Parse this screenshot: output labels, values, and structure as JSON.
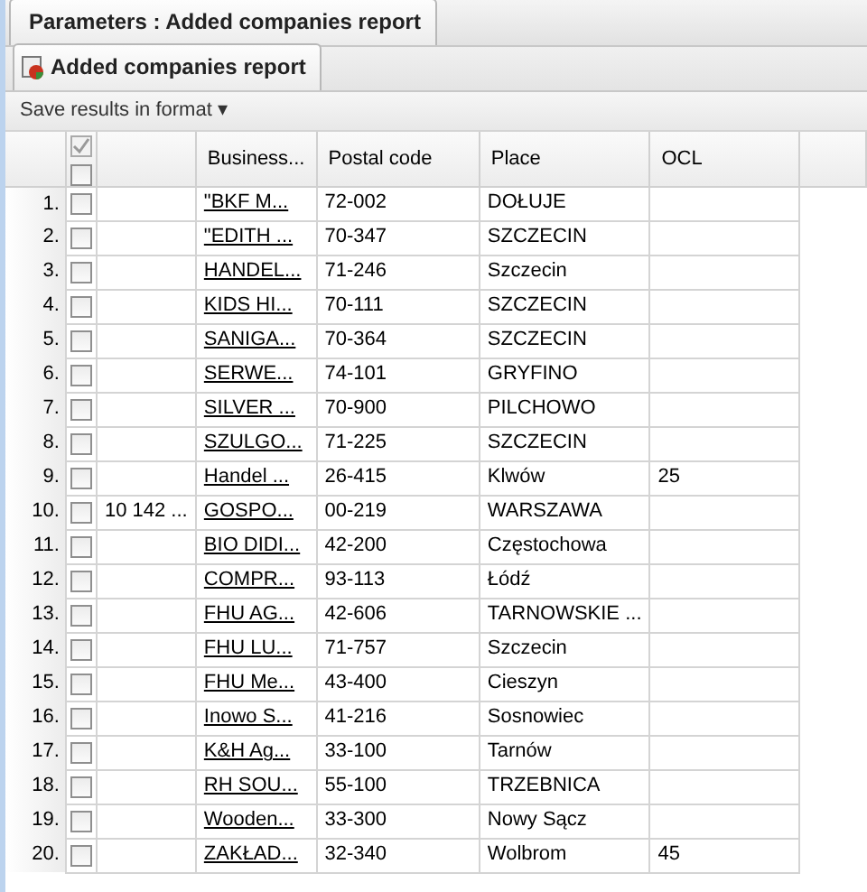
{
  "outer_tab": {
    "title": "Parameters : Added companies report",
    "selected": true
  },
  "inner_tab": {
    "title": "Added companies report",
    "selected": true
  },
  "toolbar": {
    "menu": "Save results in format",
    "caret": "▾"
  },
  "table": {
    "select_all_checked": false,
    "columns": [
      "",
      "Business...",
      "Postal code",
      "Place",
      "OCL"
    ],
    "rows": [
      {
        "number": "1.",
        "checked": false,
        "column_2": "",
        "business": "\"BKF M...",
        "postal_code": "72-002",
        "place": "DOŁUJE",
        "ocl": ""
      },
      {
        "number": "2.",
        "checked": false,
        "column_2": "",
        "business": "\"EDITH ...",
        "postal_code": "70-347",
        "place": "SZCZECIN",
        "ocl": ""
      },
      {
        "number": "3.",
        "checked": false,
        "column_2": "",
        "business": "HANDEL...",
        "postal_code": "71-246",
        "place": "Szczecin",
        "ocl": ""
      },
      {
        "number": "4.",
        "checked": false,
        "column_2": "",
        "business": "KIDS HI...",
        "postal_code": "70-111",
        "place": "SZCZECIN",
        "ocl": ""
      },
      {
        "number": "5.",
        "checked": false,
        "column_2": "",
        "business": "SANIGA...",
        "postal_code": "70-364",
        "place": "SZCZECIN",
        "ocl": ""
      },
      {
        "number": "6.",
        "checked": false,
        "column_2": "",
        "business": "SERWE...",
        "postal_code": "74-101",
        "place": "GRYFINO",
        "ocl": ""
      },
      {
        "number": "7.",
        "checked": false,
        "column_2": "",
        "business": "SILVER ...",
        "postal_code": "70-900",
        "place": "PILCHOWO",
        "ocl": ""
      },
      {
        "number": "8.",
        "checked": false,
        "column_2": "",
        "business": "SZULGO...",
        "postal_code": "71-225",
        "place": "SZCZECIN",
        "ocl": ""
      },
      {
        "number": "9.",
        "checked": false,
        "column_2": "",
        "business": "Handel ...",
        "postal_code": "26-415",
        "place": "Klwów",
        "ocl": "25"
      },
      {
        "number": "10.",
        "checked": false,
        "column_2": "10 142 ...",
        "business": "GOSPO...",
        "postal_code": "00-219",
        "place": "WARSZAWA",
        "ocl": ""
      },
      {
        "number": "11.",
        "checked": false,
        "column_2": "",
        "business": "BIO DIDI...",
        "postal_code": "42-200",
        "place": "Częstochowa",
        "ocl": ""
      },
      {
        "number": "12.",
        "checked": false,
        "column_2": "",
        "business": "COMPR...",
        "postal_code": "93-113",
        "place": "Łódź",
        "ocl": ""
      },
      {
        "number": "13.",
        "checked": false,
        "column_2": "",
        "business": "FHU AG...",
        "postal_code": "42-606",
        "place": "TARNOWSKIE ...",
        "ocl": ""
      },
      {
        "number": "14.",
        "checked": false,
        "column_2": "",
        "business": "FHU LU...",
        "postal_code": "71-757",
        "place": "Szczecin",
        "ocl": ""
      },
      {
        "number": "15.",
        "checked": false,
        "column_2": "",
        "business": "FHU Me...",
        "postal_code": "43-400",
        "place": "Cieszyn",
        "ocl": ""
      },
      {
        "number": "16.",
        "checked": false,
        "column_2": "",
        "business": "Inowo S...",
        "postal_code": "41-216",
        "place": "Sosnowiec",
        "ocl": ""
      },
      {
        "number": "17.",
        "checked": false,
        "column_2": "",
        "business": "K&H Ag...",
        "postal_code": "33-100",
        "place": "Tarnów",
        "ocl": ""
      },
      {
        "number": "18.",
        "checked": false,
        "column_2": "",
        "business": "RH SOU...",
        "postal_code": "55-100",
        "place": "TRZEBNICA",
        "ocl": ""
      },
      {
        "number": "19.",
        "checked": false,
        "column_2": "",
        "business": "Wooden...",
        "postal_code": "33-300",
        "place": "Nowy Sącz",
        "ocl": ""
      },
      {
        "number": "20.",
        "checked": false,
        "column_2": "",
        "business": "ZAKŁAD...",
        "postal_code": "32-340",
        "place": "Wolbrom",
        "ocl": "45"
      }
    ]
  }
}
